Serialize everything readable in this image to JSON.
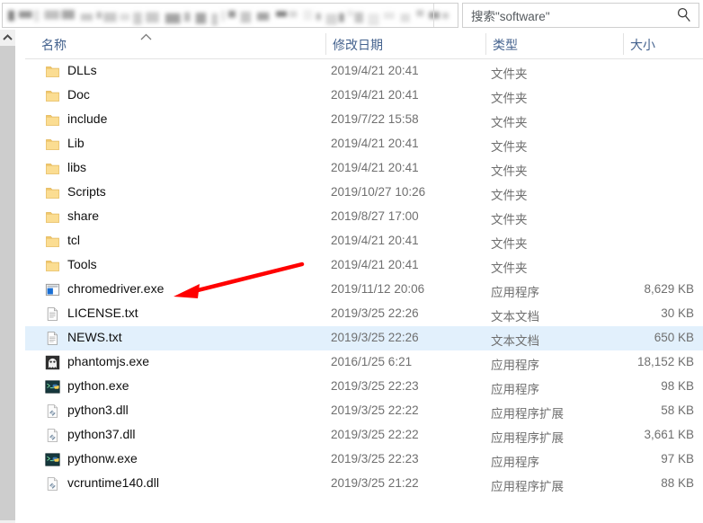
{
  "window": {
    "address_bar": {
      "blurred": true,
      "value": ""
    },
    "search": {
      "placeholder": "搜索\"software\"",
      "icon": "search-icon"
    }
  },
  "columns": {
    "name": "名称",
    "date_modified": "修改日期",
    "type": "类型",
    "size": "大小",
    "sort_by": "名称",
    "sort_direction": "ascending"
  },
  "colors": {
    "header_text": "#44628e",
    "selection": "#e2f0fc",
    "folder_icon": "#f5cb6b",
    "annotation": "#ff0000"
  },
  "annotation": {
    "type": "arrow",
    "color": "#ff0000",
    "points_to": "chromedriver.exe"
  },
  "files": [
    {
      "name": "DLLs",
      "date": "2019/4/21 20:41",
      "type": "文件夹",
      "size": "",
      "icon": "folder-icon",
      "selected": false
    },
    {
      "name": "Doc",
      "date": "2019/4/21 20:41",
      "type": "文件夹",
      "size": "",
      "icon": "folder-icon",
      "selected": false
    },
    {
      "name": "include",
      "date": "2019/7/22 15:58",
      "type": "文件夹",
      "size": "",
      "icon": "folder-icon",
      "selected": false
    },
    {
      "name": "Lib",
      "date": "2019/4/21 20:41",
      "type": "文件夹",
      "size": "",
      "icon": "folder-icon",
      "selected": false
    },
    {
      "name": "libs",
      "date": "2019/4/21 20:41",
      "type": "文件夹",
      "size": "",
      "icon": "folder-icon",
      "selected": false
    },
    {
      "name": "Scripts",
      "date": "2019/10/27 10:26",
      "type": "文件夹",
      "size": "",
      "icon": "folder-icon",
      "selected": false
    },
    {
      "name": "share",
      "date": "2019/8/27 17:00",
      "type": "文件夹",
      "size": "",
      "icon": "folder-icon",
      "selected": false
    },
    {
      "name": "tcl",
      "date": "2019/4/21 20:41",
      "type": "文件夹",
      "size": "",
      "icon": "folder-icon",
      "selected": false
    },
    {
      "name": "Tools",
      "date": "2019/4/21 20:41",
      "type": "文件夹",
      "size": "",
      "icon": "folder-icon",
      "selected": false
    },
    {
      "name": "chromedriver.exe",
      "date": "2019/11/12 20:06",
      "type": "应用程序",
      "size": "8,629 KB",
      "icon": "application-icon",
      "selected": false
    },
    {
      "name": "LICENSE.txt",
      "date": "2019/3/25 22:26",
      "type": "文本文档",
      "size": "30 KB",
      "icon": "text-file-icon",
      "selected": false
    },
    {
      "name": "NEWS.txt",
      "date": "2019/3/25 22:26",
      "type": "文本文档",
      "size": "650 KB",
      "icon": "text-file-icon",
      "selected": true
    },
    {
      "name": "phantomjs.exe",
      "date": "2016/1/25 6:21",
      "type": "应用程序",
      "size": "18,152 KB",
      "icon": "ghost-icon",
      "selected": false
    },
    {
      "name": "python.exe",
      "date": "2019/3/25 22:23",
      "type": "应用程序",
      "size": "98 KB",
      "icon": "python-icon",
      "selected": false
    },
    {
      "name": "python3.dll",
      "date": "2019/3/25 22:22",
      "type": "应用程序扩展",
      "size": "58 KB",
      "icon": "dll-icon",
      "selected": false
    },
    {
      "name": "python37.dll",
      "date": "2019/3/25 22:22",
      "type": "应用程序扩展",
      "size": "3,661 KB",
      "icon": "dll-icon",
      "selected": false
    },
    {
      "name": "pythonw.exe",
      "date": "2019/3/25 22:23",
      "type": "应用程序",
      "size": "97 KB",
      "icon": "python-icon",
      "selected": false
    },
    {
      "name": "vcruntime140.dll",
      "date": "2019/3/25 21:22",
      "type": "应用程序扩展",
      "size": "88 KB",
      "icon": "dll-icon",
      "selected": false
    }
  ]
}
